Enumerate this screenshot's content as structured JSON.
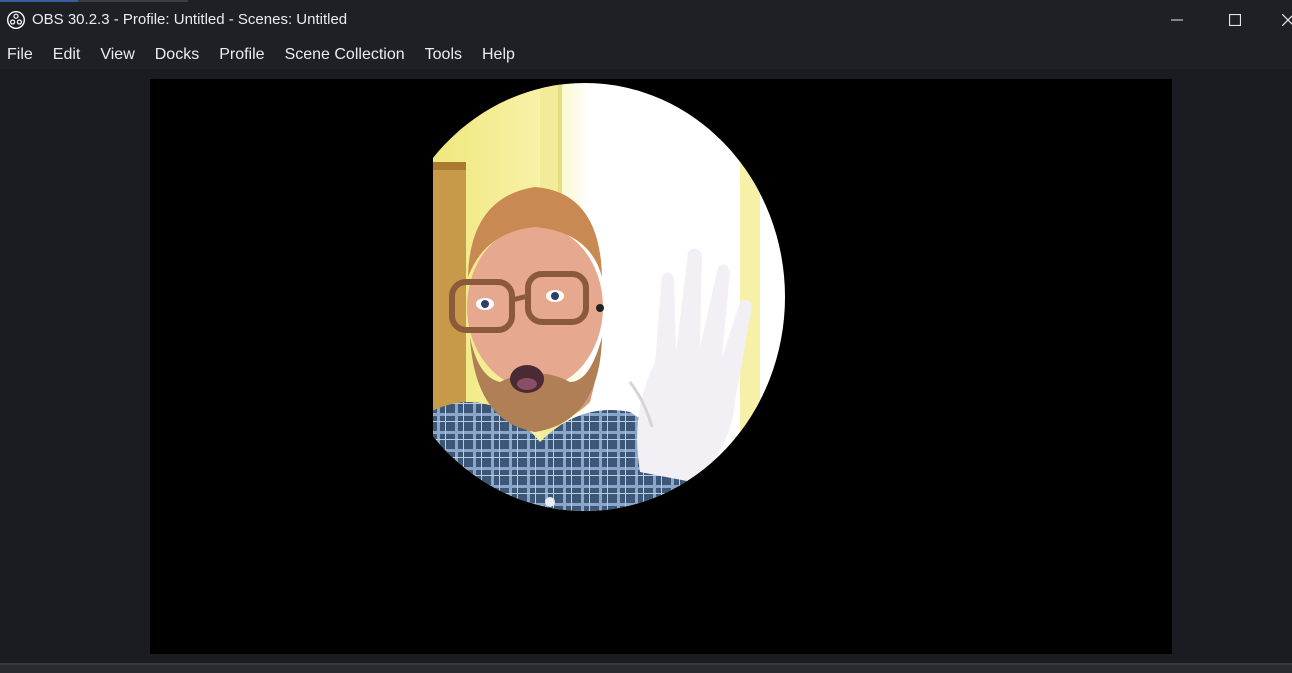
{
  "window": {
    "title": "OBS 30.2.3 - Profile: Untitled - Scenes: Untitled",
    "controls": {
      "minimize": "minimize-icon",
      "maximize": "maximize-icon",
      "close": "close-icon"
    }
  },
  "menu": {
    "items": [
      {
        "label": "File"
      },
      {
        "label": "Edit"
      },
      {
        "label": "View"
      },
      {
        "label": "Docks"
      },
      {
        "label": "Profile"
      },
      {
        "label": "Scene Collection"
      },
      {
        "label": "Tools"
      },
      {
        "label": "Help"
      }
    ]
  },
  "preview": {
    "source": "webcam-circle-mask",
    "background_color": "#000000"
  },
  "colors": {
    "titlebar": "#1f2026",
    "workspace": "#1b1c21",
    "text": "#ececec"
  }
}
